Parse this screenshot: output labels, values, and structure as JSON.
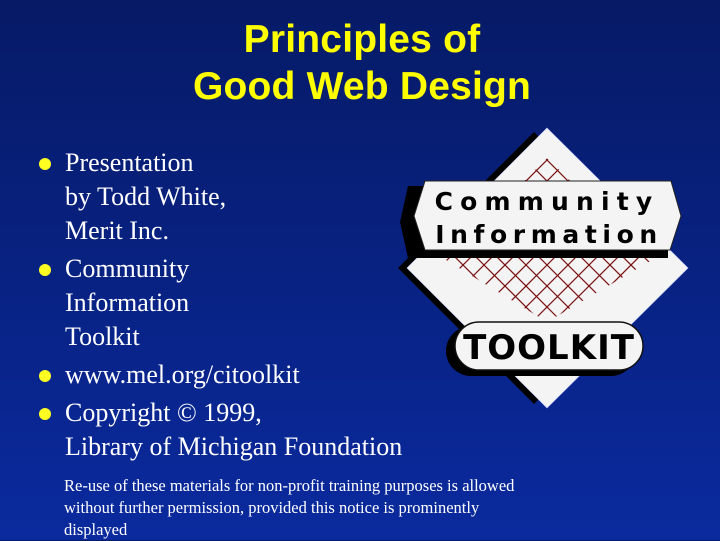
{
  "slide": {
    "title_lines": [
      "Principles of",
      "Good Web Design"
    ],
    "bullets": [
      {
        "lines": [
          "Presentation",
          "by Todd White,",
          "Merit Inc."
        ]
      },
      {
        "lines": [
          "Community",
          "Information",
          "Toolkit"
        ]
      },
      {
        "lines": [
          "www.mel.org/citoolkit"
        ]
      },
      {
        "lines": [
          "Copyright © 1999,",
          "Library of Michigan Foundation"
        ]
      }
    ],
    "notice_lines": [
      "Re-use of these materials for non-profit training purposes is allowed",
      "without further permission, provided this notice is prominently",
      "displayed"
    ]
  },
  "logo": {
    "line1": "Community",
    "line2": "Information",
    "badge": "TOOLKIT"
  },
  "colors": {
    "title": "#ffff00",
    "bullet": "#ffff22",
    "text": "#ffffff",
    "bg_top": "#061a66",
    "bg_bottom": "#0a2a9e",
    "grid": "#7a1010"
  }
}
